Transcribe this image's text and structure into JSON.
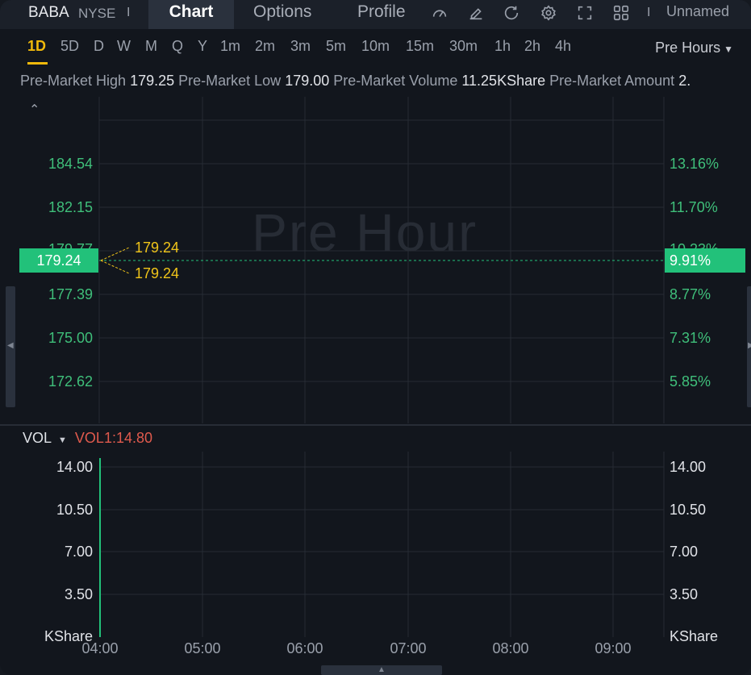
{
  "header": {
    "ticker": "BABA",
    "exchange": "NYSE",
    "separator": "I",
    "tabs": [
      {
        "label": "Chart",
        "active": true
      },
      {
        "label": "Options",
        "active": false
      },
      {
        "label": "Profile",
        "active": false
      }
    ],
    "icons": [
      "gauge-icon",
      "edit-icon",
      "refresh-icon",
      "gear-icon",
      "fullscreen-icon",
      "layout-grid-icon"
    ],
    "layout_name": "Unnamed"
  },
  "intervals": {
    "items": [
      "1D",
      "5D",
      "D",
      "W",
      "M",
      "Q",
      "Y",
      "1m",
      "2m",
      "3m",
      "5m",
      "10m",
      "15m",
      "30m",
      "1h",
      "2h",
      "4h"
    ],
    "active": "1D",
    "session": "Pre Hours"
  },
  "info": {
    "high_label": "Pre-Market High",
    "high_value": "179.25",
    "low_label": "Pre-Market Low",
    "low_value": "179.00",
    "volume_label": "Pre-Market Volume",
    "volume_value": "11.25KShare",
    "amount_label": "Pre-Market Amount",
    "amount_value": "2."
  },
  "chart": {
    "watermark": "Pre Hour",
    "price_axis_left": [
      "184.54",
      "182.15",
      "179.77",
      "177.39",
      "175.00",
      "172.62"
    ],
    "price_axis_right": [
      "13.16%",
      "11.70%",
      "10.23%",
      "8.77%",
      "7.31%",
      "5.85%"
    ],
    "current_price": "179.24",
    "current_change": "9.91%",
    "high_label": "179.24",
    "low_label": "179.24",
    "accent_color": "#22c17a",
    "hl_color": "#f0c419"
  },
  "volume": {
    "label": "VOL",
    "series_label": "VOL1:14.80",
    "axis_left": [
      "14.00",
      "10.50",
      "7.00",
      "3.50",
      "KShare"
    ],
    "axis_right": [
      "14.00",
      "10.50",
      "7.00",
      "3.50",
      "KShare"
    ],
    "value": 14.8
  },
  "x_axis": [
    "04:00",
    "05:00",
    "06:00",
    "07:00",
    "08:00",
    "09:00"
  ]
}
